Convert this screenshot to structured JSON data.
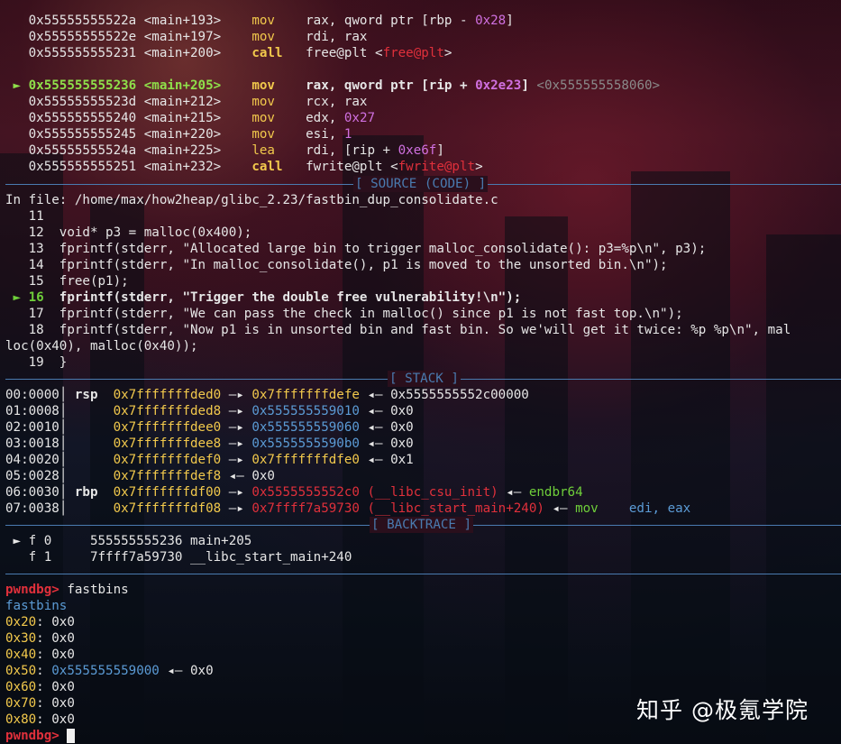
{
  "disasm": [
    {
      "marker": "",
      "addr": "0x55555555522a",
      "sym": "<main+193>",
      "mnem": "mov",
      "ops": "rax, qword ptr [rbp - ",
      "ops_num": "0x28",
      "ops_tail": "]",
      "current": false
    },
    {
      "marker": "",
      "addr": "0x55555555522e",
      "sym": "<main+197>",
      "mnem": "mov",
      "ops": "rdi, rax",
      "current": false
    },
    {
      "marker": "",
      "addr": "0x555555555231",
      "sym": "<main+200>",
      "mnem": "call",
      "ops": "free@plt <",
      "ops_red": "free@plt",
      "ops_tail": ">",
      "current": false
    },
    {
      "marker": "►",
      "addr": "0x555555555236",
      "sym": "<main+205>",
      "mnem": "mov",
      "ops": "rax, qword ptr [rip + ",
      "ops_num": "0x2e23",
      "ops_tail": "]",
      "ops_extra": "<0x555555558060>",
      "current": true
    },
    {
      "marker": "",
      "addr": "0x55555555523d",
      "sym": "<main+212>",
      "mnem": "mov",
      "ops": "rcx, rax",
      "current": false
    },
    {
      "marker": "",
      "addr": "0x555555555240",
      "sym": "<main+215>",
      "mnem": "mov",
      "ops": "edx, ",
      "ops_num": "0x27",
      "current": false
    },
    {
      "marker": "",
      "addr": "0x555555555245",
      "sym": "<main+220>",
      "mnem": "mov",
      "ops": "esi, ",
      "ops_num": "1",
      "current": false
    },
    {
      "marker": "",
      "addr": "0x55555555524a",
      "sym": "<main+225>",
      "mnem": "lea",
      "ops": "rdi, [rip + ",
      "ops_num": "0xe6f",
      "ops_tail": "]",
      "current": false
    },
    {
      "marker": "",
      "addr": "0x555555555251",
      "sym": "<main+232>",
      "mnem": "call",
      "ops": "fwrite@plt <",
      "ops_red": "fwrite@plt",
      "ops_tail": ">",
      "current": false
    }
  ],
  "source_header": "[ SOURCE (CODE) ]",
  "source_file": "In file: /home/max/how2heap/glibc_2.23/fastbin_dup_consolidate.c",
  "source": [
    {
      "n": "11",
      "marker": "",
      "code": ""
    },
    {
      "n": "12",
      "marker": "",
      "code": "void* p3 = malloc(0x400);"
    },
    {
      "n": "13",
      "marker": "",
      "code": "fprintf(stderr, \"Allocated large bin to trigger malloc_consolidate(): p3=%p\\n\", p3);"
    },
    {
      "n": "14",
      "marker": "",
      "code": "fprintf(stderr, \"In malloc_consolidate(), p1 is moved to the unsorted bin.\\n\");"
    },
    {
      "n": "15",
      "marker": "",
      "code": "free(p1);"
    },
    {
      "n": "16",
      "marker": "►",
      "code": "fprintf(stderr, \"Trigger the double free vulnerability!\\n\");"
    },
    {
      "n": "17",
      "marker": "",
      "code": "fprintf(stderr, \"We can pass the check in malloc() since p1 is not fast top.\\n\");"
    },
    {
      "n": "18",
      "marker": "",
      "code": "fprintf(stderr, \"Now p1 is in unsorted bin and fast bin. So we'will get it twice: %p %p\\n\", mal"
    },
    {
      "n": "",
      "marker": "",
      "code": "loc(0x40), malloc(0x40));"
    },
    {
      "n": "19",
      "marker": "",
      "code": "}"
    }
  ],
  "stack_header": "[ STACK ]",
  "stack": [
    {
      "off": "00:0000",
      "reg": "rsp",
      "addr": "0x7fffffffded0",
      "arrow": "—▸",
      "val": "0x7fffffffdefe",
      "val_color": "yellow",
      "arrow2": "◂—",
      "tail": "0x5555555552c00000",
      "tail_color": "white"
    },
    {
      "off": "01:0008",
      "reg": "",
      "addr": "0x7fffffffded8",
      "arrow": "—▸",
      "val": "0x555555559010",
      "val_color": "blue",
      "arrow2": "◂—",
      "tail": "0x0",
      "tail_color": "white"
    },
    {
      "off": "02:0010",
      "reg": "",
      "addr": "0x7fffffffdee0",
      "arrow": "—▸",
      "val": "0x555555559060",
      "val_color": "blue",
      "arrow2": "◂—",
      "tail": "0x0",
      "tail_color": "white"
    },
    {
      "off": "03:0018",
      "reg": "",
      "addr": "0x7fffffffdee8",
      "arrow": "—▸",
      "val": "0x5555555590b0",
      "val_color": "blue",
      "arrow2": "◂—",
      "tail": "0x0",
      "tail_color": "white"
    },
    {
      "off": "04:0020",
      "reg": "",
      "addr": "0x7fffffffdef0",
      "arrow": "—▸",
      "val": "0x7fffffffdfe0",
      "val_color": "yellow",
      "arrow2": "◂—",
      "tail": "0x1",
      "tail_color": "white"
    },
    {
      "off": "05:0028",
      "reg": "",
      "addr": "0x7fffffffdef8",
      "arrow": "",
      "val": "",
      "val_color": "white",
      "arrow2": "◂—",
      "tail": "0x0",
      "tail_color": "white"
    },
    {
      "off": "06:0030",
      "reg": "rbp",
      "addr": "0x7fffffffdf00",
      "arrow": "—▸",
      "val": "0x5555555552c0 (__libc_csu_init)",
      "val_color": "red",
      "arrow2": "◂—",
      "tail": "endbr64",
      "tail_color": "green"
    },
    {
      "off": "07:0038",
      "reg": "",
      "addr": "0x7fffffffdf08",
      "arrow": "—▸",
      "val": "0x7ffff7a59730 (__libc_start_main+240)",
      "val_color": "red",
      "arrow2": "◂—",
      "tail": "mov",
      "tail_color": "green",
      "tail2": "edi, eax"
    }
  ],
  "backtrace_header": "[ BACKTRACE ]",
  "backtrace": [
    {
      "marker": "►",
      "frame": "f 0",
      "addr": "555555555236",
      "sym": "main+205"
    },
    {
      "marker": "",
      "frame": "f 1",
      "addr": "7ffff7a59730",
      "sym": "__libc_start_main+240"
    }
  ],
  "prompt": "pwndbg>",
  "command": "fastbins",
  "fastbins_title": "fastbins",
  "fastbins": [
    {
      "size": "0x20",
      "value": "0x0",
      "ptr": ""
    },
    {
      "size": "0x30",
      "value": "0x0",
      "ptr": ""
    },
    {
      "size": "0x40",
      "value": "0x0",
      "ptr": ""
    },
    {
      "size": "0x50",
      "value": "0x0",
      "ptr": "0x555555559000"
    },
    {
      "size": "0x60",
      "value": "0x0",
      "ptr": ""
    },
    {
      "size": "0x70",
      "value": "0x0",
      "ptr": ""
    },
    {
      "size": "0x80",
      "value": "0x0",
      "ptr": ""
    }
  ],
  "watermark": "知乎 @极氪学院",
  "colors": {
    "yellow": "#f2c94c",
    "blue": "#5b9bd5",
    "red": "#e0303b",
    "green": "#6fcf3a",
    "separator": "#4a7bb0"
  }
}
